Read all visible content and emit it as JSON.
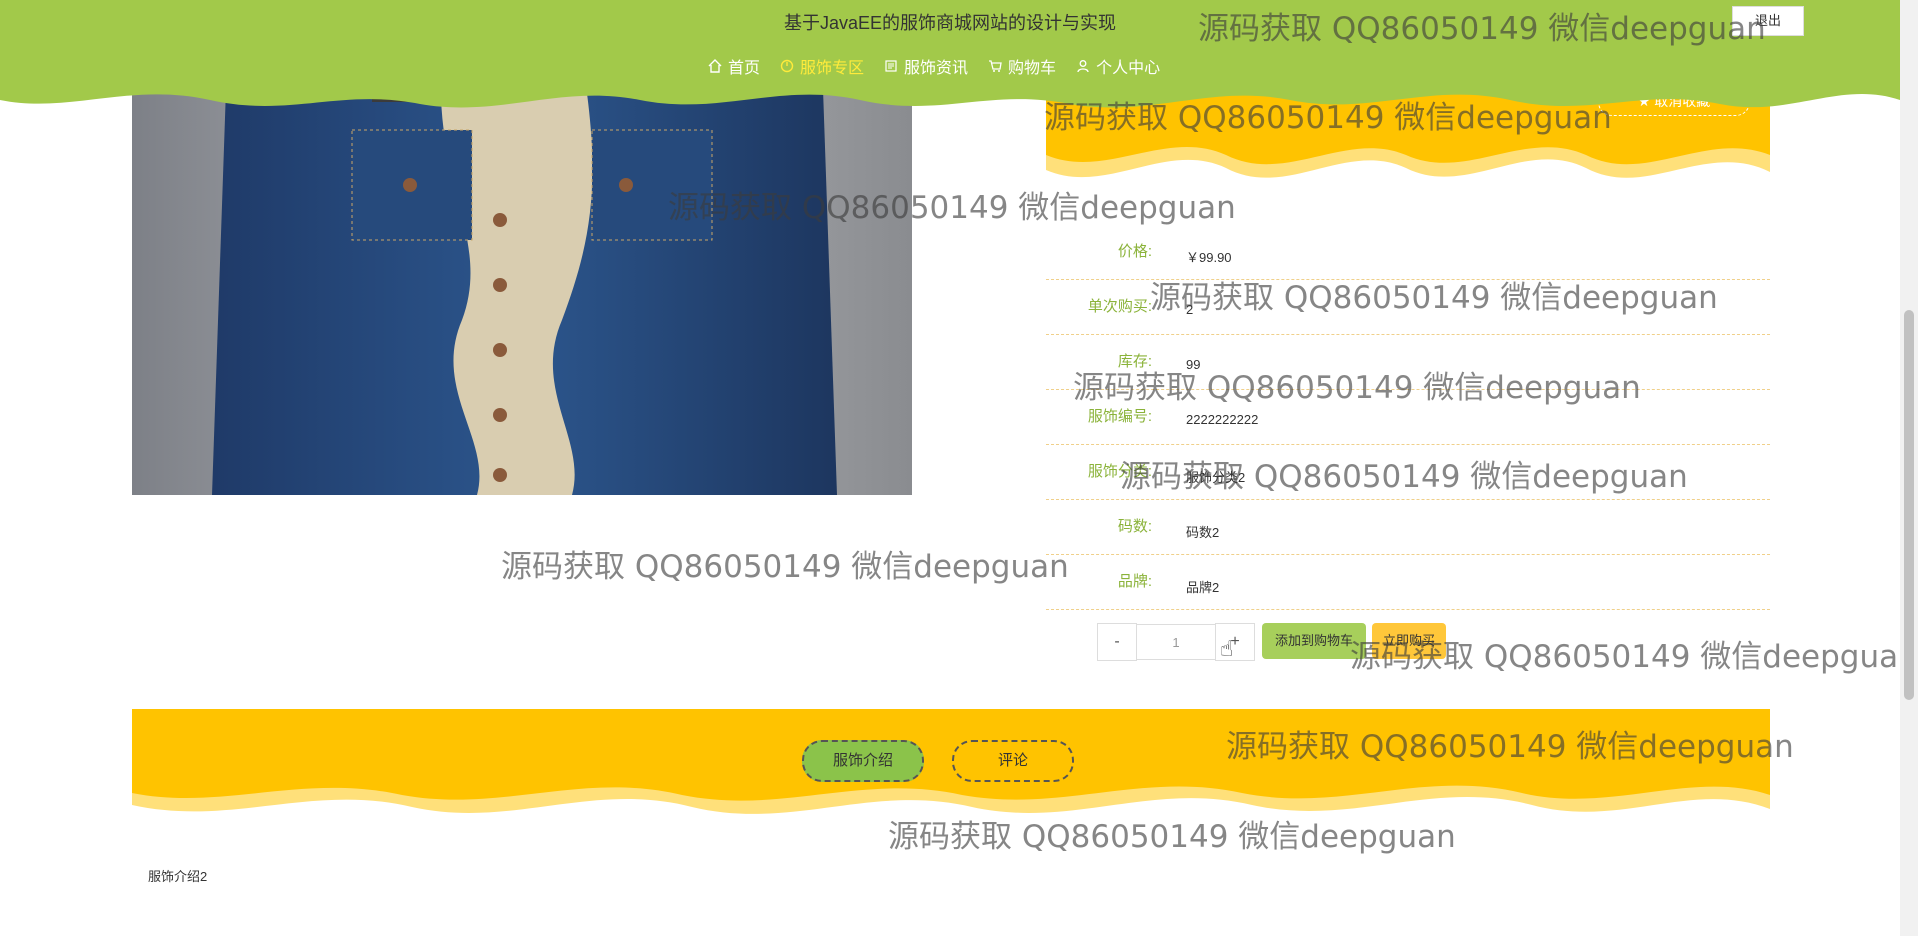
{
  "header": {
    "site_title": "基于JavaEE的服饰商城网站的设计与实现",
    "logout_label": "退出",
    "nav": [
      {
        "label": "首页",
        "icon": "home-icon"
      },
      {
        "label": "服饰专区",
        "icon": "clock-icon",
        "active": true
      },
      {
        "label": "服饰资讯",
        "icon": "news-icon"
      },
      {
        "label": "购物车",
        "icon": "cart-icon"
      },
      {
        "label": "个人中心",
        "icon": "user-icon"
      }
    ]
  },
  "favorite_label": "★ 取消收藏",
  "details": [
    {
      "label": "价格:",
      "value": "￥99.90"
    },
    {
      "label": "单次购买:",
      "value": "2"
    },
    {
      "label": "库存:",
      "value": "99"
    },
    {
      "label": "服饰编号:",
      "value": "2222222222"
    },
    {
      "label": "服饰分类:",
      "value": "服饰分类2"
    },
    {
      "label": "码数:",
      "value": "码数2"
    },
    {
      "label": "品牌:",
      "value": "品牌2"
    }
  ],
  "quantity": {
    "minus": "-",
    "value": "1",
    "plus": "+"
  },
  "buttons": {
    "add_to_cart": "添加到购物车",
    "buy_now": "立即购买"
  },
  "tabs": [
    {
      "label": "服饰介绍",
      "active": true
    },
    {
      "label": "评论",
      "active": false
    }
  ],
  "description": "服饰介绍2",
  "watermark": "源码获取 QQ86050149 微信deepguan",
  "colors": {
    "header_green": "#a2c94a",
    "accent_yellow": "#ffc300",
    "label_green": "#8bb33a"
  }
}
